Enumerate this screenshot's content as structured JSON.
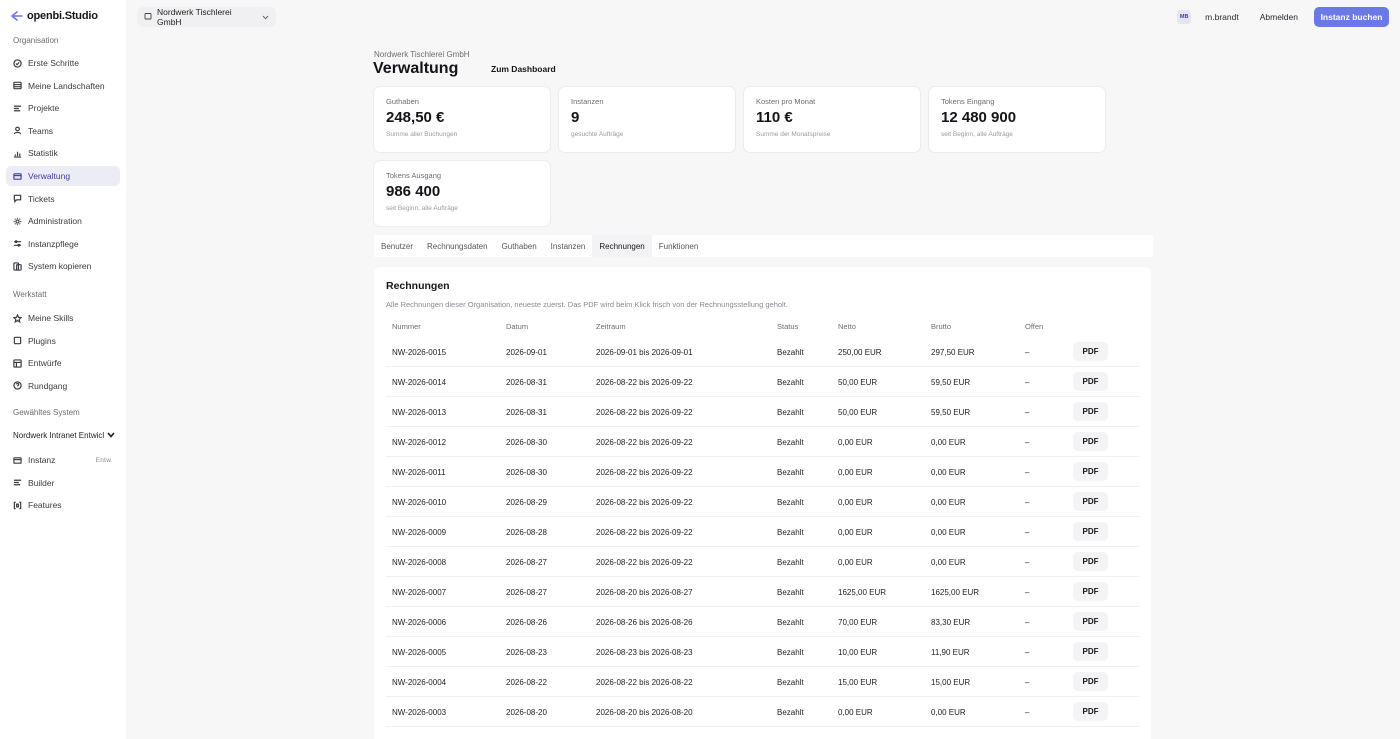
{
  "brand": {
    "name": "openbi.Studio"
  },
  "topbar": {
    "org_name": "Nordwerk Tischlerei GmbH",
    "avatar_initials": "MB",
    "username": "m.brandt",
    "logout_label": "Abmelden",
    "primary_button": "Instanz buchen",
    "accent_color": "#6b79e6"
  },
  "sidebar": {
    "section_org": "Organisation",
    "org_items": [
      {
        "label": "Erste Schritte",
        "icon": "check-circle-icon"
      },
      {
        "label": "Meine Landschaften",
        "icon": "layers-icon"
      },
      {
        "label": "Projekte",
        "icon": "list-icon"
      },
      {
        "label": "Teams",
        "icon": "user-icon"
      },
      {
        "label": "Statistik",
        "icon": "bar-chart-icon"
      },
      {
        "label": "Verwaltung",
        "icon": "card-icon"
      },
      {
        "label": "Tickets",
        "icon": "chat-icon"
      },
      {
        "label": "Administration",
        "icon": "sun-icon"
      },
      {
        "label": "Instanzpflege",
        "icon": "sliders-icon"
      },
      {
        "label": "System kopieren",
        "icon": "copy-icon"
      }
    ],
    "section_workshop": "Werkstatt",
    "workshop_items": [
      {
        "label": "Meine Skills",
        "icon": "star-icon"
      },
      {
        "label": "Plugins",
        "icon": "square-icon"
      },
      {
        "label": "Entwürfe",
        "icon": "layout-icon"
      },
      {
        "label": "Rundgang",
        "icon": "help-circle-icon"
      }
    ],
    "section_system": "Gewähltes System",
    "system_select": "Nordwerk Intranet Entwicl",
    "system_items": [
      {
        "label": "Instanz",
        "icon": "card-icon",
        "badge": "Entw."
      },
      {
        "label": "Builder",
        "icon": "list-icon"
      },
      {
        "label": "Features",
        "icon": "brackets-icon"
      }
    ]
  },
  "main": {
    "org_breadcrumb": "Nordwerk Tischlerei GmbH",
    "title": "Verwaltung",
    "dashboard_link": "Zum Dashboard",
    "kpis": [
      {
        "label": "Guthaben",
        "value": "248,50 €",
        "sub": "Summe aller Buchungen"
      },
      {
        "label": "Instanzen",
        "value": "9",
        "sub": "gesuchte Aufträge"
      },
      {
        "label": "Kosten pro Monat",
        "value": "110 €",
        "sub": "Summe der Monatspreise"
      },
      {
        "label": "Tokens Eingang",
        "value": "12 480 900",
        "sub": "seit Beginn, alle Aufträge"
      },
      {
        "label": "Tokens Ausgang",
        "value": "986 400",
        "sub": "seit Beginn, alle Aufträge"
      }
    ],
    "tabs": [
      "Benutzer",
      "Rechnungsdaten",
      "Guthaben",
      "Instanzen",
      "Rechnungen",
      "Funktionen"
    ],
    "active_tab": "Rechnungen"
  },
  "invoices": {
    "title": "Rechnungen",
    "description": "Alle Rechnungen dieser Organisation, neueste zuerst. Das PDF wird beim Klick frisch von der Rechnungsstellung geholt.",
    "columns": [
      "Nummer",
      "Datum",
      "Zeitraum",
      "Status",
      "Netto",
      "Brutto",
      "Offen"
    ],
    "pdf_label": "PDF",
    "rows": [
      [
        "NW-2026-0015",
        "2026-09-01",
        "2026-09-01 bis 2026-09-01",
        "Bezahlt",
        "250,00 EUR",
        "297,50 EUR",
        "–"
      ],
      [
        "NW-2026-0014",
        "2026-08-31",
        "2026-08-22 bis 2026-09-22",
        "Bezahlt",
        "50,00 EUR",
        "59,50 EUR",
        "–"
      ],
      [
        "NW-2026-0013",
        "2026-08-31",
        "2026-08-22 bis 2026-09-22",
        "Bezahlt",
        "50,00 EUR",
        "59,50 EUR",
        "–"
      ],
      [
        "NW-2026-0012",
        "2026-08-30",
        "2026-08-22 bis 2026-09-22",
        "Bezahlt",
        "0,00 EUR",
        "0,00 EUR",
        "–"
      ],
      [
        "NW-2026-0011",
        "2026-08-30",
        "2026-08-22 bis 2026-09-22",
        "Bezahlt",
        "0,00 EUR",
        "0,00 EUR",
        "–"
      ],
      [
        "NW-2026-0010",
        "2026-08-29",
        "2026-08-22 bis 2026-09-22",
        "Bezahlt",
        "0,00 EUR",
        "0,00 EUR",
        "–"
      ],
      [
        "NW-2026-0009",
        "2026-08-28",
        "2026-08-22 bis 2026-09-22",
        "Bezahlt",
        "0,00 EUR",
        "0,00 EUR",
        "–"
      ],
      [
        "NW-2026-0008",
        "2026-08-27",
        "2026-08-22 bis 2026-09-22",
        "Bezahlt",
        "0,00 EUR",
        "0,00 EUR",
        "–"
      ],
      [
        "NW-2026-0007",
        "2026-08-27",
        "2026-08-20 bis 2026-08-27",
        "Bezahlt",
        "1625,00 EUR",
        "1625,00 EUR",
        "–"
      ],
      [
        "NW-2026-0006",
        "2026-08-26",
        "2026-08-26 bis 2026-08-26",
        "Bezahlt",
        "70,00 EUR",
        "83,30 EUR",
        "–"
      ],
      [
        "NW-2026-0005",
        "2026-08-23",
        "2026-08-23 bis 2026-08-23",
        "Bezahlt",
        "10,00 EUR",
        "11,90 EUR",
        "–"
      ],
      [
        "NW-2026-0004",
        "2026-08-22",
        "2026-08-22 bis 2026-08-22",
        "Bezahlt",
        "15,00 EUR",
        "15,00 EUR",
        "–"
      ],
      [
        "NW-2026-0003",
        "2026-08-20",
        "2026-08-20 bis 2026-08-20",
        "Bezahlt",
        "0,00 EUR",
        "0,00 EUR",
        "–"
      ]
    ]
  }
}
